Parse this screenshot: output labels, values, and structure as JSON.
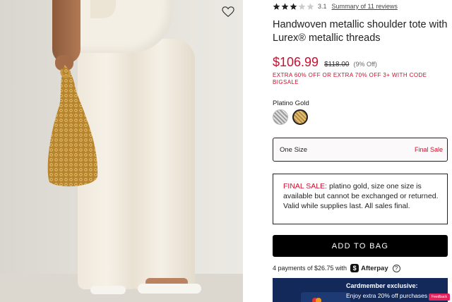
{
  "product": {
    "rating": "3.1",
    "rating_stars": 3.1,
    "reviews_link": "Summary of 11 reviews",
    "title": "Handwoven metallic shoulder tote with Lurex® metallic threads",
    "price": "$106.99",
    "original_price": "$118.00",
    "percent_off": "(9% Off)",
    "promo": "EXTRA 60% OFF OR EXTRA 70% OFF 3+ WITH CODE BIGSALE",
    "color_label": "Platino Gold",
    "swatches": [
      {
        "name": "silver-swatch",
        "selected": false
      },
      {
        "name": "gold-swatch",
        "selected": true
      }
    ],
    "size": {
      "name": "One Size",
      "note": "Final Sale"
    },
    "notice": {
      "label": "FINAL SALE:",
      "text": " platino gold, size one size is available but cannot be exchanged or returned. Valid while supplies last. All sales final."
    },
    "add_to_bag": "ADD TO BAG",
    "afterpay": {
      "text": "4 payments of $26.75 with",
      "brand": "Afterpay",
      "mark": "$",
      "info": "?"
    },
    "card_banner": {
      "title": "Cardmember exclusive:",
      "text": "Enjoy extra 20% off purchases"
    },
    "feedback_tag": "Feedback"
  },
  "colors": {
    "sale_red": "#c8102e",
    "button_black": "#000000",
    "banner_navy": "#13295a"
  }
}
